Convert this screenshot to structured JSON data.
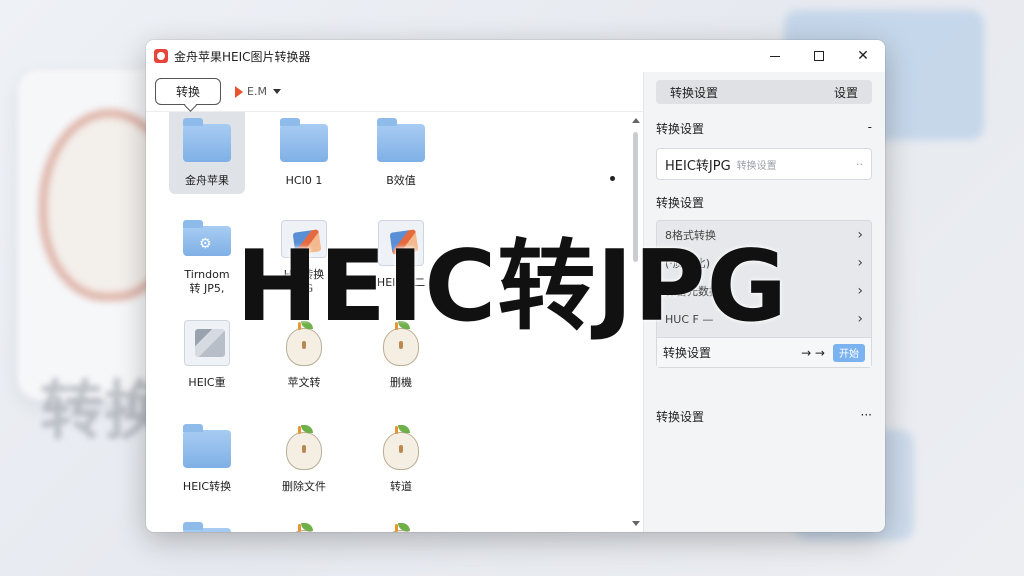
{
  "window": {
    "title": "金舟苹果HEIC图片转换器",
    "minimize_icon": "minimize-icon",
    "maximize_icon": "maximize-icon",
    "close_glyph": "✕"
  },
  "toolbar": {
    "convert_label": "转换",
    "mode_label": "E.M"
  },
  "files": [
    {
      "label": "金舟苹果",
      "icon": "folder",
      "selected": true
    },
    {
      "label": "HCI0 1",
      "icon": "folder",
      "selected": false
    },
    {
      "label": "B效值",
      "icon": "folder",
      "selected": false
    },
    {
      "label": "Tirndom\n转 JP5,",
      "icon": "folder-gear",
      "selected": false
    },
    {
      "label": "HEI转换\nJPG",
      "icon": "image-doc",
      "selected": false
    },
    {
      "label": "HEIC转二",
      "icon": "image-doc",
      "selected": false
    },
    {
      "label": "HEIC重",
      "icon": "gray-doc",
      "selected": false
    },
    {
      "label": "苹文转",
      "icon": "apple",
      "selected": false
    },
    {
      "label": "删機",
      "icon": "apple",
      "selected": false
    },
    {
      "label": "HEIC转换",
      "icon": "folder",
      "selected": false
    },
    {
      "label": "删除文件",
      "icon": "apple",
      "selected": false
    },
    {
      "label": "转道",
      "icon": "apple",
      "selected": false
    },
    {
      "label": "",
      "icon": "folder",
      "selected": false
    },
    {
      "label": "",
      "icon": "apple",
      "selected": false
    },
    {
      "label": "",
      "icon": "apple",
      "selected": false
    }
  ],
  "settings": {
    "tab_left": "转换设置",
    "tab_right": "设置",
    "section1": "转换设置",
    "section1_toggle": "-",
    "format_value": "HEIC转JPG",
    "format_hint": "转换设置",
    "format_clear": "··",
    "section2": "转换设置",
    "options": [
      {
        "label": "8格式转换"
      },
      {
        "label": "(·质量比)"
      },
      {
        "label": "保留元数据"
      },
      {
        "label": "HUC  F — "
      }
    ],
    "last_row_label": "转换设置",
    "last_row_arrows": "→ →",
    "action_label": "开始",
    "section3": "转换设置",
    "section3_more": "···"
  },
  "overlay": {
    "headline": "HEIC转JPG"
  }
}
